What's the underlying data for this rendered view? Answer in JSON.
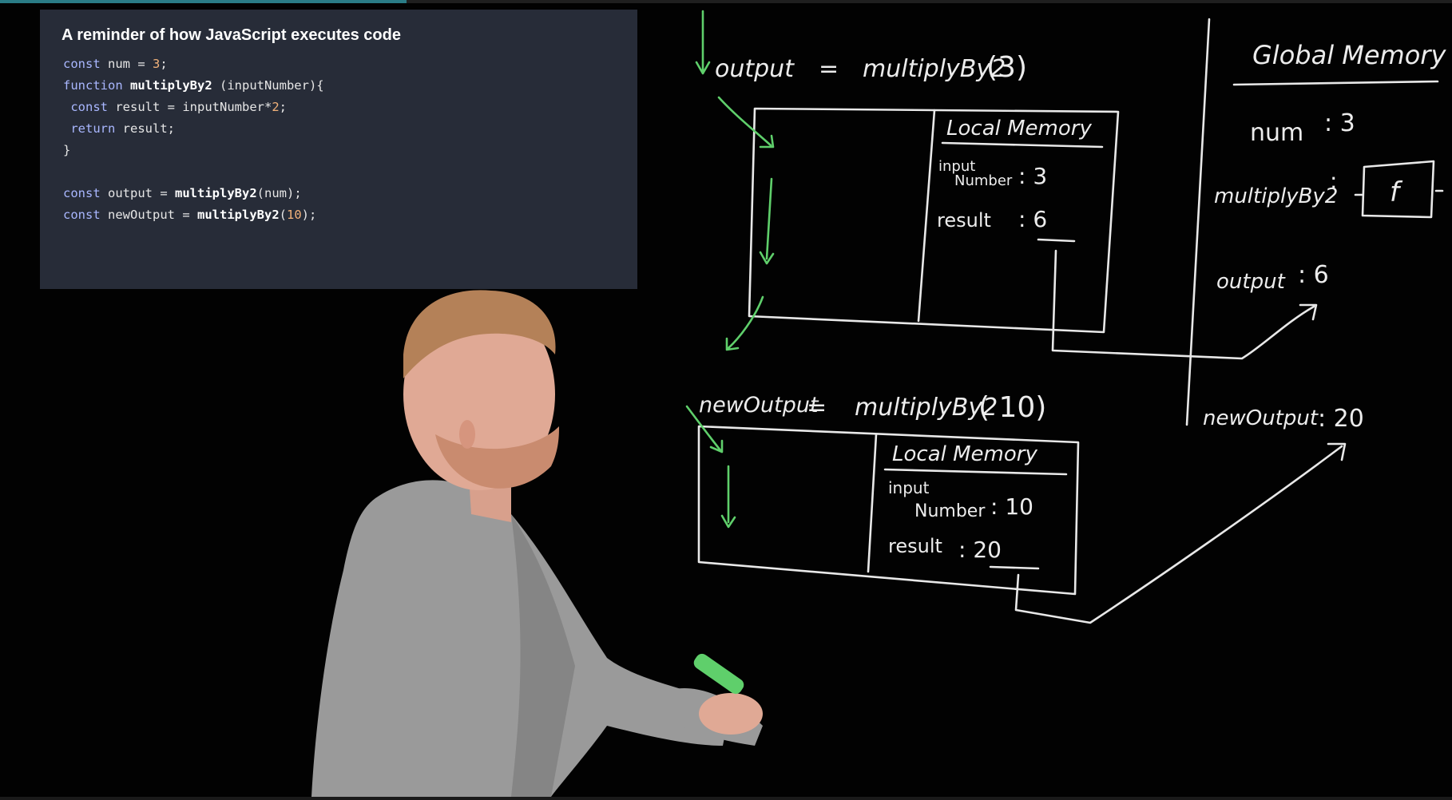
{
  "video": {
    "progress_fraction": 0.28,
    "accent_color": "#2a7c86"
  },
  "code_panel": {
    "title": "A reminder of how JavaScript executes code",
    "lines": [
      [
        {
          "k": "kw",
          "t": "const"
        },
        {
          "k": "plain",
          "t": " num = "
        },
        {
          "k": "num",
          "t": "3"
        },
        {
          "k": "plain",
          "t": ";"
        }
      ],
      [
        {
          "k": "kw",
          "t": "function"
        },
        {
          "k": "plain",
          "t": " "
        },
        {
          "k": "fn",
          "t": "multiplyBy2"
        },
        {
          "k": "plain",
          "t": " (inputNumber){"
        }
      ],
      [
        {
          "k": "plain",
          "t": " "
        },
        {
          "k": "kw",
          "t": "const"
        },
        {
          "k": "plain",
          "t": " result = inputNumber*"
        },
        {
          "k": "num",
          "t": "2"
        },
        {
          "k": "plain",
          "t": ";"
        }
      ],
      [
        {
          "k": "plain",
          "t": " "
        },
        {
          "k": "kw",
          "t": "return"
        },
        {
          "k": "plain",
          "t": " result;"
        }
      ],
      [
        {
          "k": "plain",
          "t": "}"
        }
      ],
      [],
      [
        {
          "k": "kw",
          "t": "const"
        },
        {
          "k": "plain",
          "t": " output = "
        },
        {
          "k": "fn",
          "t": "multiplyBy2"
        },
        {
          "k": "plain",
          "t": "(num);"
        }
      ],
      [
        {
          "k": "kw",
          "t": "const"
        },
        {
          "k": "plain",
          "t": " newOutput = "
        },
        {
          "k": "fn",
          "t": "multiplyBy2"
        },
        {
          "k": "plain",
          "t": "("
        },
        {
          "k": "num",
          "t": "10"
        },
        {
          "k": "plain",
          "t": ");"
        }
      ]
    ]
  },
  "whiteboard": {
    "call1": {
      "left": "output",
      "eq": "=",
      "call": "multiplyBy2",
      "arg": "(3)"
    },
    "local_memory_1": {
      "title": "Local Memory",
      "input_label_top": "input",
      "input_label_bottom": "Number",
      "input_value": ": 3",
      "result_label": "result",
      "result_value": ": 6"
    },
    "call2": {
      "left": "newOutput",
      "eq": "=",
      "call": "multiplyBy2",
      "arg": "( 10)"
    },
    "local_memory_2": {
      "title": "Local Memory",
      "input_label_top": "input",
      "input_label_bottom": "Number",
      "input_value": ": 10",
      "result_label": "result",
      "result_value": ": 20"
    },
    "global_memory": {
      "title": "Global Memory",
      "entries": [
        {
          "label": "num",
          "value": ": 3"
        },
        {
          "label": "multiplyBy2",
          "value": ":"
        },
        {
          "label": "output",
          "value": ": 6"
        },
        {
          "label": "newOutput",
          "value": ": 20"
        }
      ],
      "function_box_label": "f"
    }
  },
  "colors": {
    "chalk": "#e8e8e8",
    "green_marker": "#5fcf6b",
    "panel_bg": "#272c38",
    "keyword": "#a9b7ff",
    "number": "#f2b27a"
  }
}
